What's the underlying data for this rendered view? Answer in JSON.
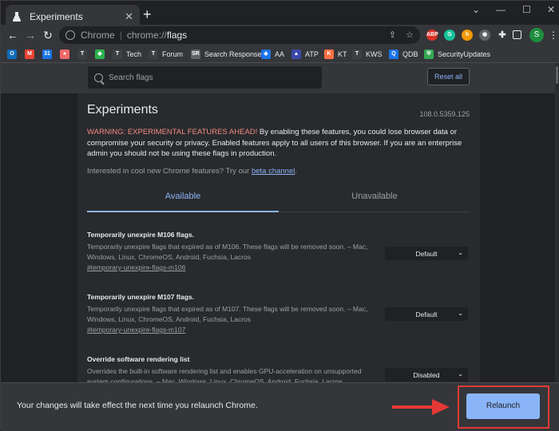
{
  "tab": {
    "title": "Experiments",
    "close": "✕",
    "new_tab": "+"
  },
  "window_controls": {
    "chevron": "⌄",
    "minimize": "—",
    "maximize": "☐",
    "close": "✕"
  },
  "toolbar": {
    "back": "←",
    "forward": "→",
    "reload": "↻",
    "site_label": "Chrome",
    "url_prefix": "chrome://",
    "url_path": "flags",
    "profile_initial": "S"
  },
  "bookmarks": [
    {
      "label": "",
      "icon": "outlook-icon",
      "color": "#0f6cbd",
      "glyph": "O"
    },
    {
      "label": "",
      "icon": "gmail-icon",
      "color": "#ea4335",
      "glyph": "M"
    },
    {
      "label": "",
      "icon": "calendar-icon",
      "color": "#1a73e8",
      "glyph": "31"
    },
    {
      "label": "",
      "icon": "asana-icon",
      "color": "#f06a6a",
      "glyph": "●"
    },
    {
      "label": "",
      "icon": "tech-icon",
      "color": "#3c4043",
      "glyph": "T"
    },
    {
      "label": "",
      "icon": "feedly-icon",
      "color": "#2bb24c",
      "glyph": "◆"
    },
    {
      "label": "Tech",
      "icon": "tech-icon",
      "color": "#3c4043",
      "glyph": "T"
    },
    {
      "label": "Forum",
      "icon": "forum-icon",
      "color": "#3c4043",
      "glyph": "T"
    },
    {
      "label": "Search Response",
      "icon": "search-response-icon",
      "color": "#5f6368",
      "glyph": "SR"
    },
    {
      "label": "AA",
      "icon": "aa-icon",
      "color": "#1a73e8",
      "glyph": "◈"
    },
    {
      "label": "ATP",
      "icon": "atp-icon",
      "color": "#3949ab",
      "glyph": "▲"
    },
    {
      "label": "KT",
      "icon": "kt-icon",
      "color": "#ff7043",
      "glyph": "K"
    },
    {
      "label": "KWS",
      "icon": "kws-icon",
      "color": "#3c4043",
      "glyph": "T"
    },
    {
      "label": "QDB",
      "icon": "qdb-icon",
      "color": "#1a73e8",
      "glyph": "Q"
    },
    {
      "label": "SecurityUpdates",
      "icon": "shield-icon",
      "color": "#34a853",
      "glyph": "⛨"
    }
  ],
  "search": {
    "placeholder": "Search flags"
  },
  "reset_label": "Reset all",
  "page_title": "Experiments",
  "version": "108.0.5359.125",
  "warning_head": "WARNING: EXPERIMENTAL FEATURES AHEAD!",
  "warning_body": " By enabling these features, you could lose browser data or compromise your security or privacy. Enabled features apply to all users of this browser. If you are an enterprise admin you should not be using these flags in production.",
  "interest_text": "Interested in cool new Chrome features? Try our ",
  "interest_link": "beta channel",
  "interest_end": ".",
  "tabs": {
    "available": "Available",
    "unavailable": "Unavailable"
  },
  "flags": [
    {
      "name": "Temporarily unexpire M106 flags.",
      "description": "Temporarily unexpire flags that expired as of M106. These flags will be removed soon. – Mac, Windows, Linux, ChromeOS, Android, Fuchsia, Lacros",
      "link": "#temporary-unexpire-flags-m106",
      "value": "Default"
    },
    {
      "name": "Temporarily unexpire M107 flags.",
      "description": "Temporarily unexpire flags that expired as of M107. These flags will be removed soon. – Mac, Windows, Linux, ChromeOS, Android, Fuchsia, Lacros",
      "link": "#temporary-unexpire-flags-m107",
      "value": "Default"
    },
    {
      "name": "Override software rendering list",
      "description": "Overrides the built-in software rendering list and enables GPU-acceleration on unsupported system configurations. – Mac, Windows, Linux, ChromeOS, Android, Fuchsia, Lacros",
      "link": "",
      "value": "Disabled"
    }
  ],
  "relaunch": {
    "message": "Your changes will take effect the next time you relaunch Chrome.",
    "button": "Relaunch"
  },
  "colors": {
    "accent": "#8ab4f8",
    "warning": "#f28b82",
    "highlight": "#e53935"
  }
}
